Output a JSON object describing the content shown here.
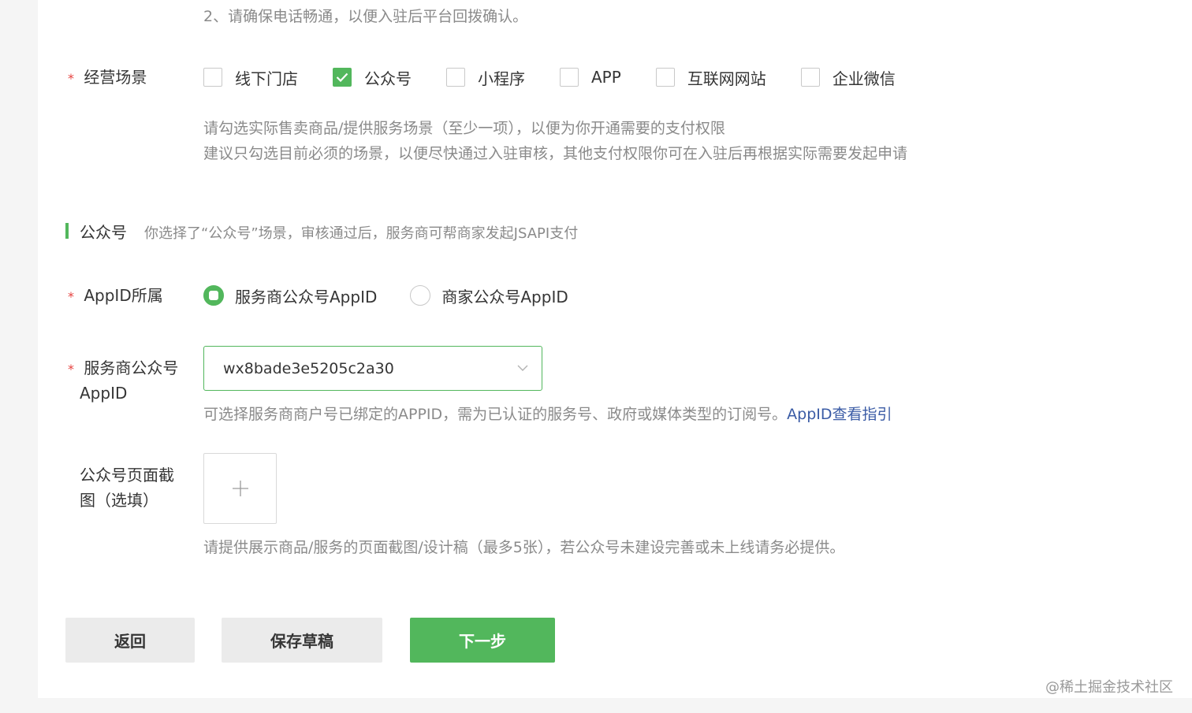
{
  "top_tip": "2、请确保电话畅通，以便入驻后平台回拨确认。",
  "scene": {
    "required_mark": "*",
    "label": "经营场景",
    "options": [
      {
        "label": "线下门店",
        "checked": false
      },
      {
        "label": "公众号",
        "checked": true
      },
      {
        "label": "小程序",
        "checked": false
      },
      {
        "label": "APP",
        "checked": false
      },
      {
        "label": "互联网网站",
        "checked": false
      },
      {
        "label": "企业微信",
        "checked": false
      }
    ],
    "tip_line1": "请勾选实际售卖商品/提供服务场景（至少一项），以便为你开通需要的支付权限",
    "tip_line2": "建议只勾选目前必须的场景，以便尽快通过入驻审核，其他支付权限你可在入驻后再根据实际需要发起申请"
  },
  "section": {
    "title": "公众号",
    "desc": "你选择了“公众号”场景，审核通过后，服务商可帮商家发起JSAPI支付"
  },
  "appid_owner": {
    "required_mark": "*",
    "label": "AppID所属",
    "options": [
      {
        "label": "服务商公众号AppID",
        "selected": true
      },
      {
        "label": "商家公众号AppID",
        "selected": false
      }
    ]
  },
  "provider_appid": {
    "required_mark": "*",
    "label_line1": "服务商公众号",
    "label_line2": "AppID",
    "value": "wx8bade3e5205c2a30",
    "tip": "可选择服务商商户号已绑定的APPID，需为已认证的服务号、政府或媒体类型的订阅号。",
    "link": "AppID查看指引"
  },
  "screenshot": {
    "label_line1": "公众号页面截",
    "label_line2": "图（选填）",
    "upload_symbol": "+",
    "tip": "请提供展示商品/服务的页面截图/设计稿（最多5张），若公众号未建设完善或未上线请务必提供。"
  },
  "buttons": {
    "back": "返回",
    "save_draft": "保存草稿",
    "next": "下一步"
  },
  "watermark": "@稀土掘金技术社区",
  "colors": {
    "accent": "#52b75c",
    "link": "#3a5ba5",
    "required": "#e64340"
  }
}
